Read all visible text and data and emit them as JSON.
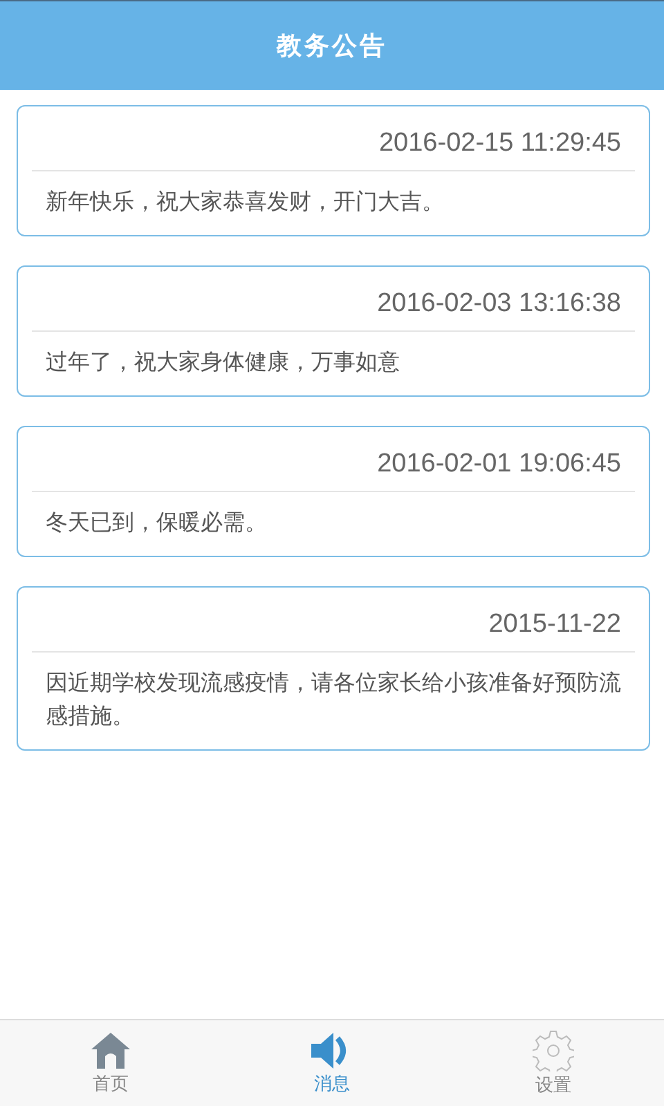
{
  "header": {
    "title": "教务公告"
  },
  "notices": [
    {
      "time": "2016-02-15 11:29:45",
      "text": "新年快乐，祝大家恭喜发财，开门大吉。"
    },
    {
      "time": "2016-02-03 13:16:38",
      "text": "过年了，祝大家身体健康，万事如意"
    },
    {
      "time": "2016-02-01 19:06:45",
      "text": "冬天已到，保暖必需。"
    },
    {
      "time": "2015-11-22",
      "text": "因近期学校发现流感疫情，请各位家长给小孩准备好预防流感措施。"
    }
  ],
  "tab_bar": [
    {
      "kind": "home",
      "label": "首页",
      "selected": false
    },
    {
      "kind": "speaker",
      "label": "消息",
      "selected": true
    },
    {
      "kind": "gear",
      "label": "设置",
      "selected": false
    }
  ]
}
